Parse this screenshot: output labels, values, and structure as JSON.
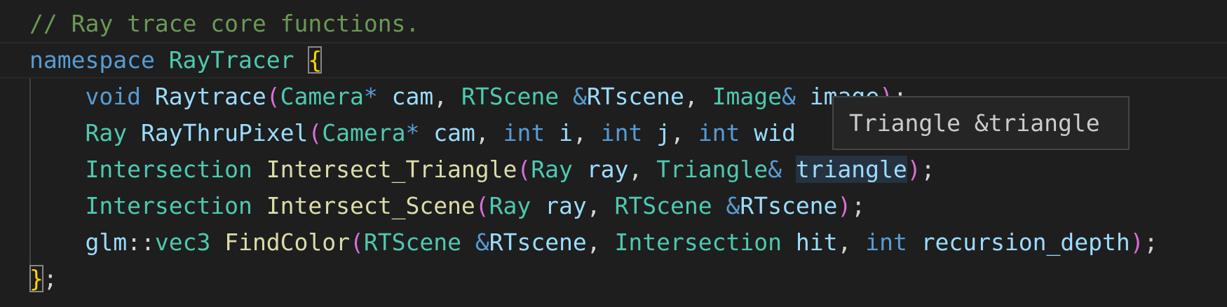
{
  "colors": {
    "background": "#1e1e1e",
    "comment": "#6a9955",
    "keyword": "#569cd6",
    "type": "#4ec9b0",
    "function": "#dcdcaa",
    "variable": "#9cdcfe",
    "punctuation": "#d4d4d4",
    "brace": "#ffd700",
    "paren": "#da70d6",
    "tooltip_background": "#252526",
    "tooltip_border": "#454545"
  },
  "editor": {
    "lines": [
      {
        "tokens": [
          {
            "text": "// Ray trace core functions.",
            "kind": "comment"
          }
        ]
      },
      {
        "tokens": [
          {
            "text": "namespace",
            "kind": "keyword"
          },
          {
            "text": " ",
            "kind": "punc"
          },
          {
            "text": "RayTracer",
            "kind": "type"
          },
          {
            "text": " ",
            "kind": "punc"
          },
          {
            "text": "{",
            "kind": "brace",
            "boxed": true
          }
        ]
      },
      {
        "tokens": [
          {
            "text": "    ",
            "kind": "punc"
          },
          {
            "text": "void",
            "kind": "keyword"
          },
          {
            "text": " ",
            "kind": "punc"
          },
          {
            "text": "Raytrace",
            "kind": "var"
          },
          {
            "text": "(",
            "kind": "paren"
          },
          {
            "text": "Camera",
            "kind": "type"
          },
          {
            "text": "*",
            "kind": "keyword"
          },
          {
            "text": " ",
            "kind": "punc"
          },
          {
            "text": "cam",
            "kind": "var"
          },
          {
            "text": ", ",
            "kind": "punc"
          },
          {
            "text": "RTScene",
            "kind": "type"
          },
          {
            "text": " ",
            "kind": "punc"
          },
          {
            "text": "&",
            "kind": "keyword"
          },
          {
            "text": "RTscene",
            "kind": "var"
          },
          {
            "text": ", ",
            "kind": "punc"
          },
          {
            "text": "Image",
            "kind": "type"
          },
          {
            "text": "&",
            "kind": "keyword"
          },
          {
            "text": " ",
            "kind": "punc"
          },
          {
            "text": "image",
            "kind": "var"
          },
          {
            "text": ")",
            "kind": "paren"
          },
          {
            "text": ";",
            "kind": "punc"
          }
        ]
      },
      {
        "tokens": [
          {
            "text": "    ",
            "kind": "punc"
          },
          {
            "text": "Ray",
            "kind": "type"
          },
          {
            "text": " ",
            "kind": "punc"
          },
          {
            "text": "RayThruPixel",
            "kind": "var"
          },
          {
            "text": "(",
            "kind": "paren"
          },
          {
            "text": "Camera",
            "kind": "type"
          },
          {
            "text": "*",
            "kind": "keyword"
          },
          {
            "text": " ",
            "kind": "punc"
          },
          {
            "text": "cam",
            "kind": "var"
          },
          {
            "text": ", ",
            "kind": "punc"
          },
          {
            "text": "int",
            "kind": "keyword"
          },
          {
            "text": " ",
            "kind": "punc"
          },
          {
            "text": "i",
            "kind": "var"
          },
          {
            "text": ", ",
            "kind": "punc"
          },
          {
            "text": "int",
            "kind": "keyword"
          },
          {
            "text": " ",
            "kind": "punc"
          },
          {
            "text": "j",
            "kind": "var"
          },
          {
            "text": ", ",
            "kind": "punc"
          },
          {
            "text": "int",
            "kind": "keyword"
          },
          {
            "text": " ",
            "kind": "punc"
          },
          {
            "text": "wid",
            "kind": "var"
          }
        ]
      },
      {
        "tokens": [
          {
            "text": "    ",
            "kind": "punc"
          },
          {
            "text": "Intersection",
            "kind": "type"
          },
          {
            "text": " ",
            "kind": "punc"
          },
          {
            "text": "Intersect_Triangle",
            "kind": "func"
          },
          {
            "text": "(",
            "kind": "paren"
          },
          {
            "text": "Ray",
            "kind": "type"
          },
          {
            "text": " ",
            "kind": "punc"
          },
          {
            "text": "ray",
            "kind": "var"
          },
          {
            "text": ", ",
            "kind": "punc"
          },
          {
            "text": "Triangle",
            "kind": "type"
          },
          {
            "text": "&",
            "kind": "keyword"
          },
          {
            "text": " ",
            "kind": "punc"
          },
          {
            "text": "triangle",
            "kind": "var",
            "highlight": true
          },
          {
            "text": ")",
            "kind": "paren"
          },
          {
            "text": ";",
            "kind": "punc"
          }
        ]
      },
      {
        "tokens": [
          {
            "text": "    ",
            "kind": "punc"
          },
          {
            "text": "Intersection",
            "kind": "type"
          },
          {
            "text": " ",
            "kind": "punc"
          },
          {
            "text": "Intersect_Scene",
            "kind": "func"
          },
          {
            "text": "(",
            "kind": "paren"
          },
          {
            "text": "Ray",
            "kind": "type"
          },
          {
            "text": " ",
            "kind": "punc"
          },
          {
            "text": "ray",
            "kind": "var"
          },
          {
            "text": ", ",
            "kind": "punc"
          },
          {
            "text": "RTScene",
            "kind": "type"
          },
          {
            "text": " ",
            "kind": "punc"
          },
          {
            "text": "&",
            "kind": "keyword"
          },
          {
            "text": "RTscene",
            "kind": "var"
          },
          {
            "text": ")",
            "kind": "paren"
          },
          {
            "text": ";",
            "kind": "punc"
          }
        ]
      },
      {
        "tokens": [
          {
            "text": "    ",
            "kind": "punc"
          },
          {
            "text": "glm",
            "kind": "var"
          },
          {
            "text": "::",
            "kind": "punc"
          },
          {
            "text": "vec3",
            "kind": "type"
          },
          {
            "text": " ",
            "kind": "punc"
          },
          {
            "text": "FindColor",
            "kind": "func"
          },
          {
            "text": "(",
            "kind": "paren"
          },
          {
            "text": "RTScene",
            "kind": "type"
          },
          {
            "text": " ",
            "kind": "punc"
          },
          {
            "text": "&",
            "kind": "keyword"
          },
          {
            "text": "RTscene",
            "kind": "var"
          },
          {
            "text": ", ",
            "kind": "punc"
          },
          {
            "text": "Intersection",
            "kind": "type"
          },
          {
            "text": " ",
            "kind": "punc"
          },
          {
            "text": "hit",
            "kind": "var"
          },
          {
            "text": ", ",
            "kind": "punc"
          },
          {
            "text": "int",
            "kind": "keyword"
          },
          {
            "text": " ",
            "kind": "punc"
          },
          {
            "text": "recursion_depth",
            "kind": "var"
          },
          {
            "text": ")",
            "kind": "paren"
          },
          {
            "text": ";",
            "kind": "punc"
          }
        ]
      },
      {
        "tokens": [
          {
            "text": "}",
            "kind": "brace",
            "boxed": true
          },
          {
            "text": ";",
            "kind": "punc"
          }
        ]
      }
    ]
  },
  "tooltip": {
    "text": "Triangle &triangle"
  }
}
